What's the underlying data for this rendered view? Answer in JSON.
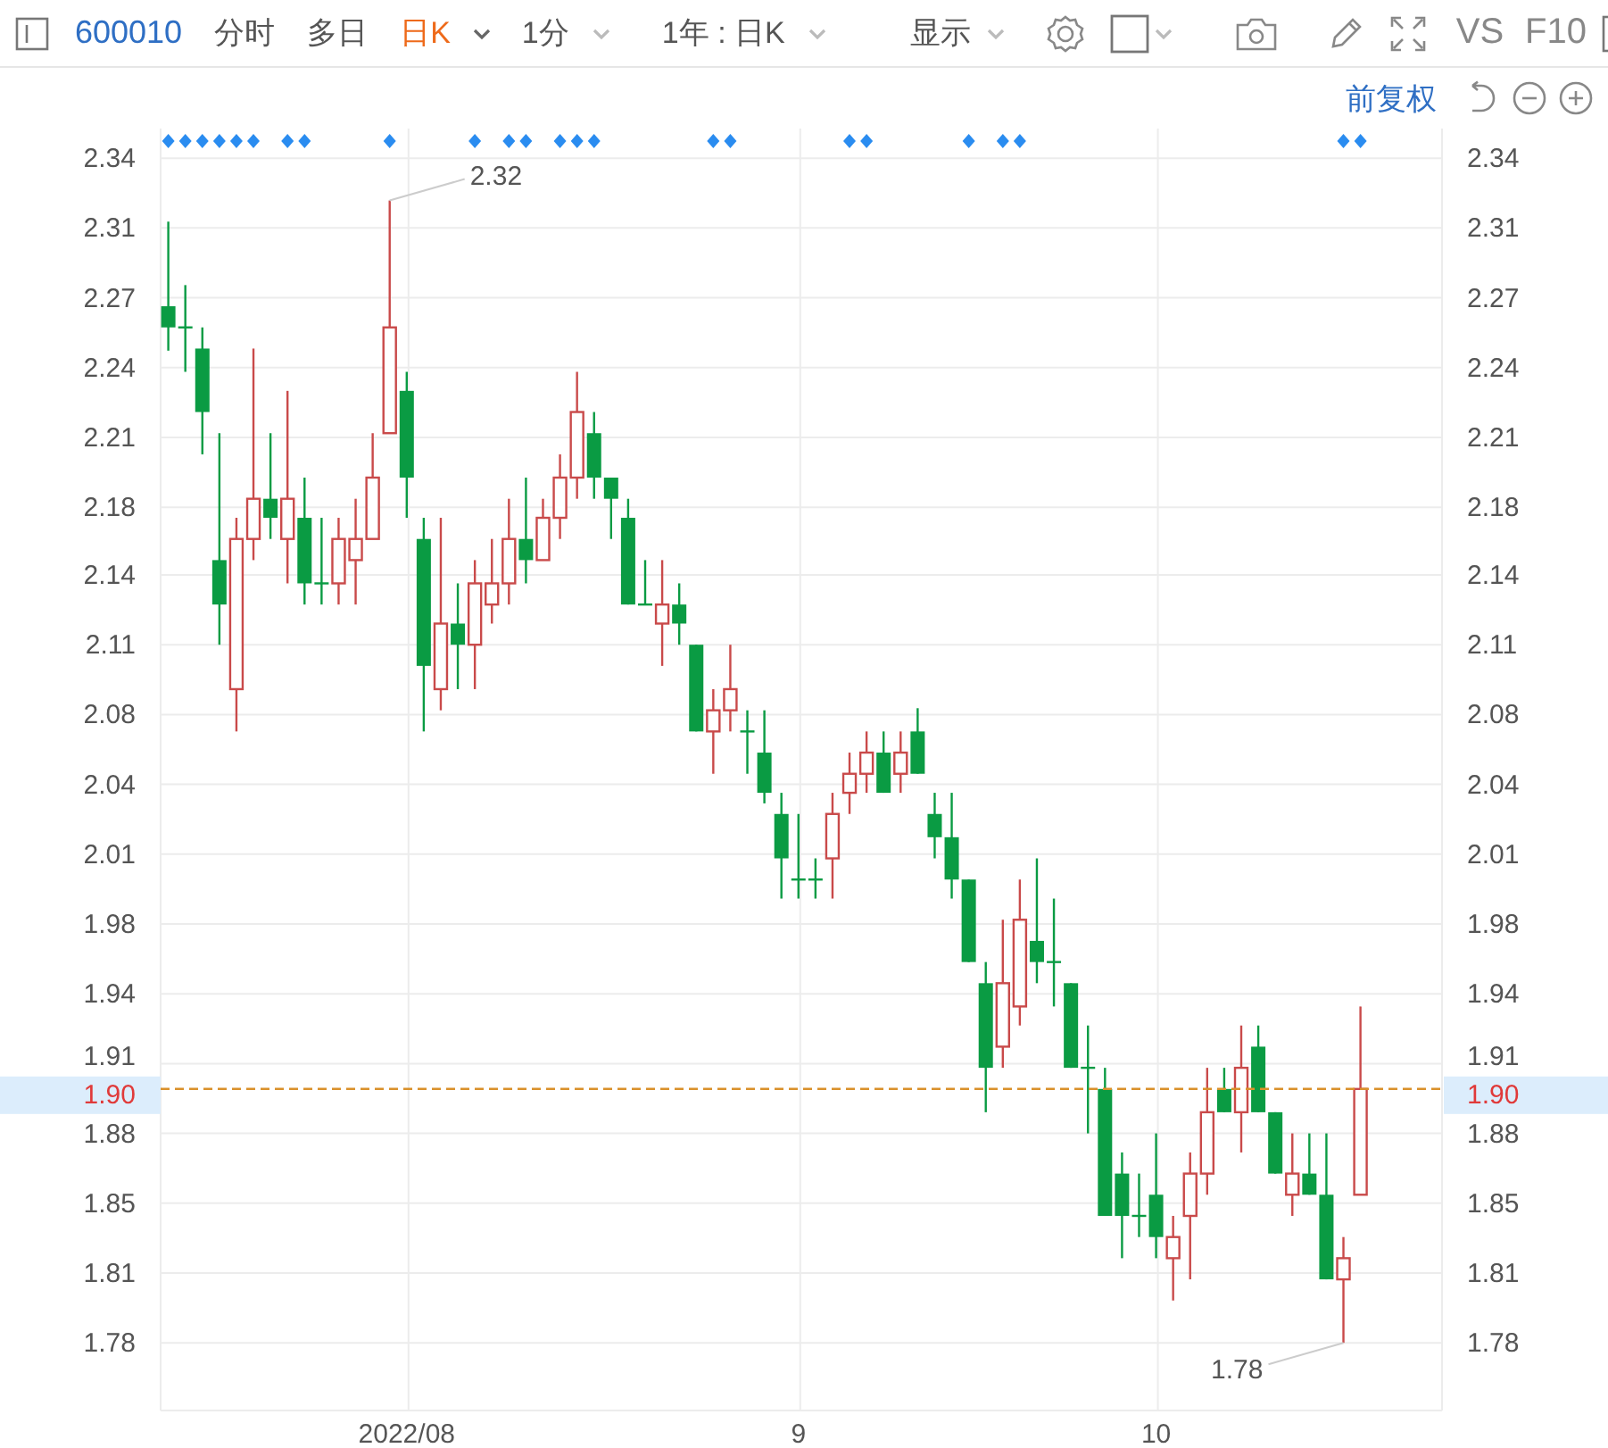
{
  "toolbar": {
    "symbol": "600010",
    "tabs": [
      {
        "label": "分时",
        "selected": false,
        "dropdown": false
      },
      {
        "label": "多日",
        "selected": false,
        "dropdown": false
      },
      {
        "label": "日K",
        "selected": true,
        "dropdown": true
      },
      {
        "label": "1分",
        "selected": false,
        "dropdown": true
      }
    ],
    "range": "1年 : 日K",
    "display": "显示",
    "buttons": [
      "VS",
      "F10"
    ]
  },
  "chart": {
    "adjust": "前复权",
    "chart_data": {
      "type": "candlestick",
      "grid": true,
      "ylim": [
        1.748,
        2.354
      ],
      "yticks": [
        {
          "value": 2.34,
          "label": "2.34"
        },
        {
          "value": 2.307,
          "label": "2.31"
        },
        {
          "value": 2.274,
          "label": "2.27"
        },
        {
          "value": 2.241,
          "label": "2.24"
        },
        {
          "value": 2.208,
          "label": "2.21"
        },
        {
          "value": 2.175,
          "label": "2.18"
        },
        {
          "value": 2.143,
          "label": "2.14"
        },
        {
          "value": 2.11,
          "label": "2.11"
        },
        {
          "value": 2.077,
          "label": "2.08"
        },
        {
          "value": 2.044,
          "label": "2.04"
        },
        {
          "value": 2.011,
          "label": "2.01"
        },
        {
          "value": 1.978,
          "label": "1.98"
        },
        {
          "value": 1.945,
          "label": "1.94"
        },
        {
          "value": 1.912,
          "label": "1.91"
        },
        {
          "value": 1.879,
          "label": "1.88"
        },
        {
          "value": 1.846,
          "label": "1.85"
        },
        {
          "value": 1.813,
          "label": "1.81"
        },
        {
          "value": 1.78,
          "label": "1.78"
        }
      ],
      "categories": [
        null,
        null,
        null,
        null,
        null,
        null,
        null,
        null,
        null,
        null,
        null,
        null,
        null,
        null,
        "2022/08",
        null,
        null,
        null,
        null,
        null,
        null,
        null,
        null,
        null,
        null,
        null,
        null,
        null,
        null,
        null,
        null,
        null,
        null,
        null,
        null,
        null,
        null,
        "9",
        null,
        null,
        null,
        null,
        null,
        null,
        null,
        null,
        null,
        null,
        null,
        null,
        null,
        null,
        null,
        null,
        null,
        null,
        null,
        null,
        "10",
        null,
        null,
        null,
        null,
        null,
        null,
        null,
        null,
        null,
        null,
        null,
        null
      ],
      "ohlc": [
        [
          2.27,
          2.31,
          2.249,
          2.26
        ],
        [
          2.26,
          2.28,
          2.239,
          2.26
        ],
        [
          2.25,
          2.26,
          2.2,
          2.22
        ],
        [
          2.15,
          2.21,
          2.11,
          2.129
        ],
        [
          2.089,
          2.17,
          2.069,
          2.16
        ],
        [
          2.16,
          2.25,
          2.15,
          2.179
        ],
        [
          2.179,
          2.21,
          2.16,
          2.17
        ],
        [
          2.16,
          2.23,
          2.139,
          2.179
        ],
        [
          2.17,
          2.189,
          2.129,
          2.139
        ],
        [
          2.139,
          2.17,
          2.129,
          2.139
        ],
        [
          2.139,
          2.17,
          2.129,
          2.16
        ],
        [
          2.15,
          2.179,
          2.129,
          2.16
        ],
        [
          2.16,
          2.21,
          2.16,
          2.189
        ],
        [
          2.21,
          2.32,
          2.21,
          2.26
        ],
        [
          2.23,
          2.239,
          2.17,
          2.189
        ],
        [
          2.16,
          2.17,
          2.069,
          2.1
        ],
        [
          2.089,
          2.17,
          2.079,
          2.12
        ],
        [
          2.12,
          2.139,
          2.089,
          2.11
        ],
        [
          2.11,
          2.15,
          2.089,
          2.139
        ],
        [
          2.129,
          2.16,
          2.12,
          2.139
        ],
        [
          2.139,
          2.179,
          2.129,
          2.16
        ],
        [
          2.16,
          2.189,
          2.139,
          2.15
        ],
        [
          2.15,
          2.179,
          2.15,
          2.17
        ],
        [
          2.17,
          2.2,
          2.16,
          2.189
        ],
        [
          2.189,
          2.239,
          2.179,
          2.22
        ],
        [
          2.21,
          2.22,
          2.179,
          2.189
        ],
        [
          2.189,
          2.189,
          2.16,
          2.179
        ],
        [
          2.17,
          2.179,
          2.129,
          2.129
        ],
        [
          2.129,
          2.15,
          2.129,
          2.129
        ],
        [
          2.12,
          2.15,
          2.1,
          2.129
        ],
        [
          2.129,
          2.139,
          2.11,
          2.12
        ],
        [
          2.11,
          2.11,
          2.069,
          2.069
        ],
        [
          2.069,
          2.089,
          2.049,
          2.079
        ],
        [
          2.079,
          2.11,
          2.069,
          2.089
        ],
        [
          2.069,
          2.079,
          2.049,
          2.069
        ],
        [
          2.059,
          2.079,
          2.035,
          2.04
        ],
        [
          2.03,
          2.04,
          1.99,
          2.009
        ],
        [
          1.999,
          2.03,
          1.99,
          1.999
        ],
        [
          1.999,
          2.009,
          1.99,
          1.999
        ],
        [
          2.009,
          2.04,
          1.99,
          2.03
        ],
        [
          2.04,
          2.059,
          2.03,
          2.049
        ],
        [
          2.049,
          2.069,
          2.04,
          2.059
        ],
        [
          2.059,
          2.069,
          2.04,
          2.04
        ],
        [
          2.049,
          2.069,
          2.04,
          2.059
        ],
        [
          2.069,
          2.08,
          2.049,
          2.049
        ],
        [
          2.03,
          2.04,
          2.009,
          2.019
        ],
        [
          2.019,
          2.04,
          1.99,
          1.999
        ],
        [
          1.999,
          1.999,
          1.96,
          1.96
        ],
        [
          1.95,
          1.96,
          1.889,
          1.91
        ],
        [
          1.92,
          1.98,
          1.91,
          1.95
        ],
        [
          1.939,
          1.999,
          1.93,
          1.98
        ],
        [
          1.97,
          2.009,
          1.95,
          1.96
        ],
        [
          1.96,
          1.99,
          1.939,
          1.96
        ],
        [
          1.95,
          1.95,
          1.91,
          1.91
        ],
        [
          1.91,
          1.93,
          1.879,
          1.91
        ],
        [
          1.9,
          1.91,
          1.84,
          1.84
        ],
        [
          1.86,
          1.87,
          1.82,
          1.84
        ],
        [
          1.84,
          1.86,
          1.83,
          1.84
        ],
        [
          1.85,
          1.879,
          1.82,
          1.83
        ],
        [
          1.82,
          1.84,
          1.8,
          1.83
        ],
        [
          1.84,
          1.87,
          1.81,
          1.86
        ],
        [
          1.86,
          1.91,
          1.85,
          1.889
        ],
        [
          1.9,
          1.91,
          1.889,
          1.889
        ],
        [
          1.889,
          1.93,
          1.87,
          1.91
        ],
        [
          1.92,
          1.93,
          1.889,
          1.889
        ],
        [
          1.889,
          1.889,
          1.86,
          1.86
        ],
        [
          1.85,
          1.879,
          1.84,
          1.86
        ],
        [
          1.86,
          1.879,
          1.85,
          1.85
        ],
        [
          1.85,
          1.879,
          1.81,
          1.81
        ],
        [
          1.81,
          1.83,
          1.78,
          1.82
        ],
        [
          1.85,
          1.939,
          1.85,
          1.9
        ]
      ],
      "annotations": [
        "2.32",
        "1.78"
      ],
      "ref_lines": [
        {
          "axis": "y",
          "value": 1.9,
          "label": "1.90",
          "color": "#d9912b"
        }
      ]
    }
  }
}
